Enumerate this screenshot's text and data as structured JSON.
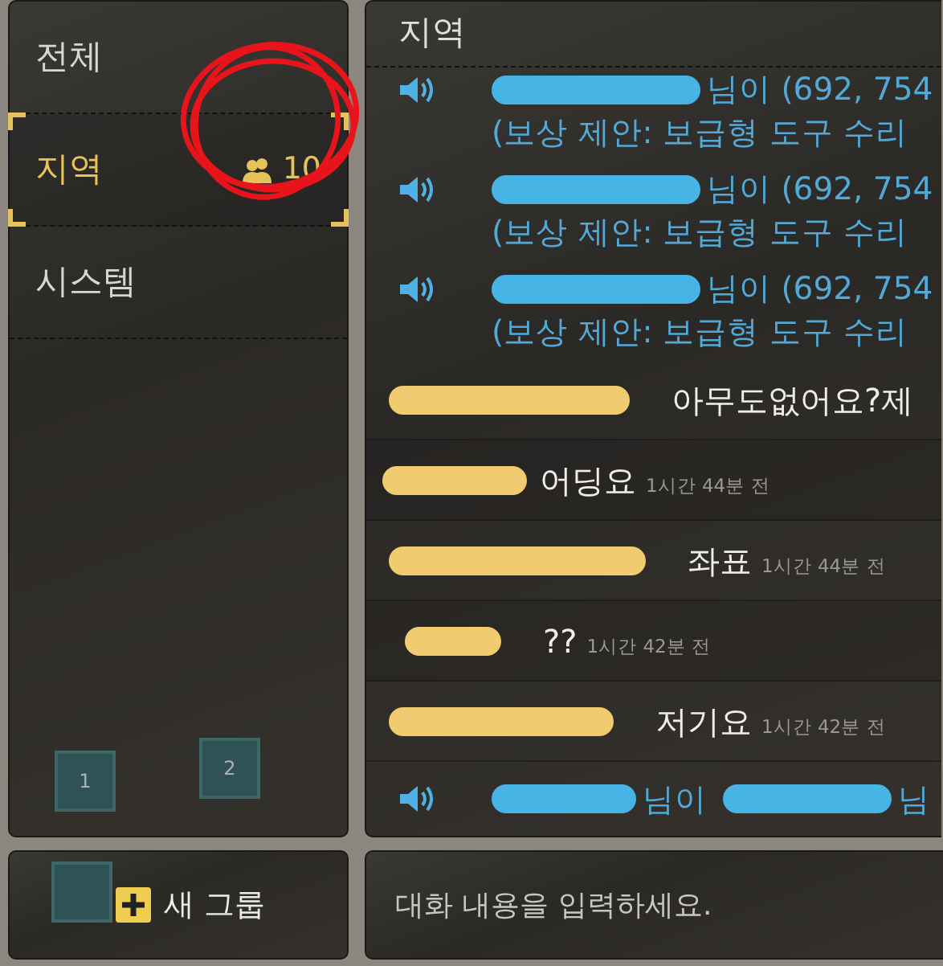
{
  "sidebar": {
    "tabs": [
      {
        "label": "전체",
        "selected": false
      },
      {
        "label": "지역",
        "selected": true,
        "member_count": "10"
      },
      {
        "label": "시스템",
        "selected": false
      }
    ],
    "slots": [
      {
        "kind": "numbered",
        "label": "1"
      },
      {
        "kind": "numbered",
        "label": "2"
      },
      {
        "kind": "empty"
      }
    ],
    "new_group_button": {
      "label": "새 그룹"
    }
  },
  "chat": {
    "title": "지역",
    "messages": [
      {
        "kind": "notice",
        "text": "님이 (692, 754",
        "detail": "(보상 제안: 보급형 도구 수리"
      },
      {
        "kind": "notice",
        "text": "님이 (692, 754",
        "detail": "(보상 제안: 보급형 도구 수리"
      },
      {
        "kind": "notice",
        "text": "님이 (692, 754",
        "detail": "(보상 제안: 보급형 도구 수리"
      },
      {
        "kind": "player",
        "text": "아무도없어요?제"
      },
      {
        "kind": "player",
        "text": "어딩요",
        "time": "1시간 44분 전"
      },
      {
        "kind": "player",
        "text": "좌표",
        "time": "1시간 44분 전"
      },
      {
        "kind": "player",
        "text": "??",
        "time": "1시간 42분 전"
      },
      {
        "kind": "player",
        "text": "저기요",
        "time": "1시간 42분 전"
      },
      {
        "kind": "notice",
        "text": "님이",
        "text_2": "님"
      }
    ]
  },
  "input": {
    "placeholder": "대화 내용을 입력하세요."
  },
  "annotation": {
    "kind": "circle"
  }
}
